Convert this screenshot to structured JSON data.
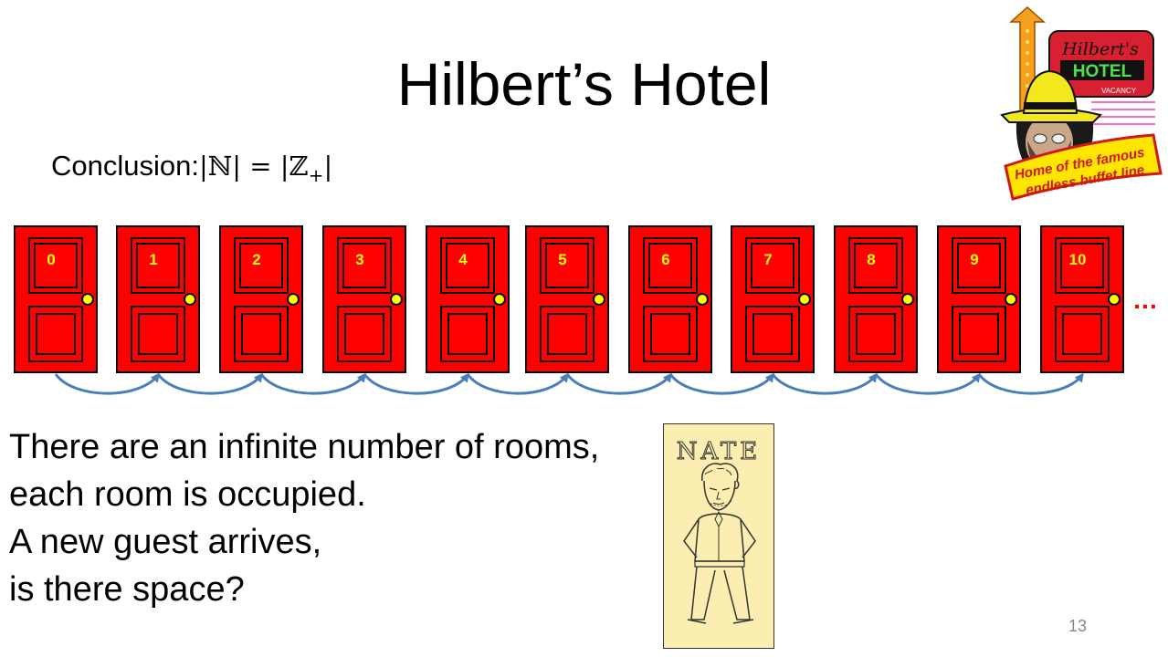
{
  "slide": {
    "title": "Hilbert’s Hotel",
    "conclusion_prefix": "Conclusion:",
    "conclusion_math_main": "|ℕ| = |ℤ",
    "conclusion_math_sub": "+",
    "conclusion_math_end": "|",
    "body_lines": [
      "There are an infinite number of rooms,",
      "each room is occupied.",
      "A new guest arrives,",
      "is there space?"
    ],
    "page_number": "13"
  },
  "doors": {
    "labels": [
      "0",
      "1",
      "2",
      "3",
      "4",
      "5",
      "6",
      "7",
      "8",
      "9",
      "10"
    ],
    "ellipsis": "…",
    "door_color": "#ff0000",
    "label_color": "#ffff00",
    "arrow_color": "#4a7ebb"
  },
  "logo": {
    "sign_line1": "Hilbert's",
    "sign_line2": "HOTEL",
    "sign_line3": "VACANCY",
    "banner_line1": "Home of the famous",
    "banner_line2": "endless buffet line"
  },
  "nate": {
    "name": "NATE"
  }
}
